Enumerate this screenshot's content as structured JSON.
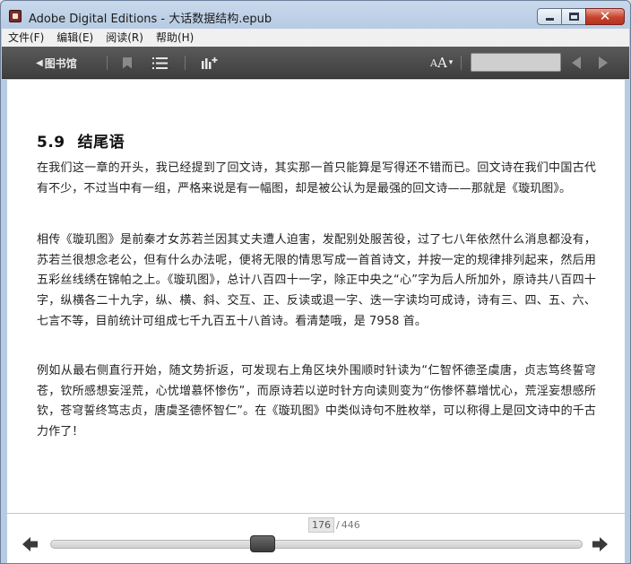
{
  "window": {
    "title": "Adobe Digital Editions - 大话数据结构.epub",
    "close_glyph": "✕"
  },
  "menu": [
    {
      "label": "文件(F)"
    },
    {
      "label": "编辑(E)"
    },
    {
      "label": "阅读(R)"
    },
    {
      "label": "帮助(H)"
    }
  ],
  "toolbar": {
    "library_arrow": "◀",
    "library_label": "图书馆",
    "font_big": "A",
    "font_small": "A",
    "font_dropdown": "▾",
    "search_value": "",
    "icons": [
      "bookmark-icon",
      "toc-icon",
      "stats-icon",
      "prev-arrow-icon",
      "next-arrow-icon"
    ]
  },
  "content": {
    "chapter_number": "5.9",
    "chapter_title": "结尾语",
    "paragraphs": [
      "在我们这一章的开头，我已经提到了回文诗，其实那一首只能算是写得还不错而已。回文诗在我们中国古代有不少，不过当中有一组，严格来说是有一幅图，却是被公认为是最强的回文诗——那就是《璇玑图》。",
      "相传《璇玑图》是前秦才女苏若兰因其丈夫遭人迫害，发配别处服苦役，过了七八年依然什么消息都没有，苏若兰很想念老公，但有什么办法呢，便将无限的情思写成一首首诗文，并按一定的规律排列起来，然后用五彩丝线绣在锦帕之上。《璇玑图》，总计八百四十一字，除正中央之“心”字为后人所加外，原诗共八百四十字，纵横各二十九字，纵、横、斜、交互、正、反读或退一字、迭一字读均可成诗，诗有三、四、五、六、七言不等，目前统计可组成七千九百五十八首诗。看清楚哦，是 7958 首。",
      "例如从最右侧直行开始，随文势折返，可发现右上角区块外围顺时针读为“仁智怀德圣虞唐，贞志笃终誓穹苍，钦所感想妄淫荒，心忧增慕怀惨伤”，而原诗若以逆时针方向读则变为“伤惨怀慕增忧心，荒淫妄想感所钦，苍穹誓终笃志贞，唐虞圣德怀智仁”。在《璇玑图》中类似诗句不胜枚举，可以称得上是回文诗中的千古力作了！"
    ]
  },
  "footer": {
    "current_page": "176",
    "separator": "/",
    "total_pages": "446",
    "progress_fraction": 0.3946
  },
  "colors": {
    "toolbar_bg": "#4a4a4a",
    "close_button": "#c8432e",
    "page_bg": "#ffffff"
  }
}
